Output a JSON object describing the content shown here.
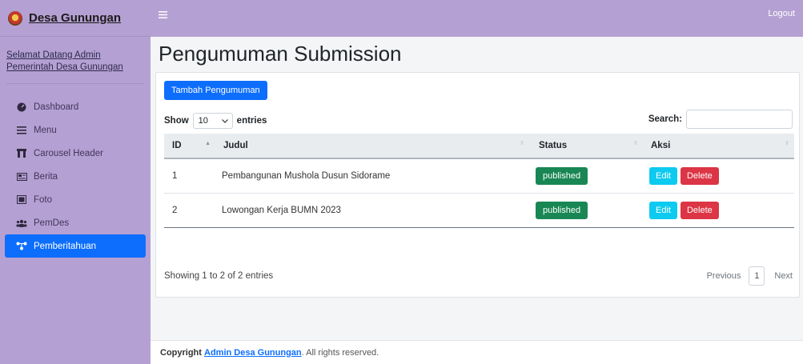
{
  "brand": {
    "name": "Desa Gunungan"
  },
  "topbar": {
    "menu_icon": "hamburger-icon",
    "logout_label": "Logout"
  },
  "sidebar": {
    "welcome": "Selamat Datang Admin Pemerintah Desa Gunungan",
    "items": [
      {
        "label": "Dashboard",
        "icon": "tachometer-icon"
      },
      {
        "label": "Menu",
        "icon": "bars-icon"
      },
      {
        "label": "Carousel Header",
        "icon": "archway-icon"
      },
      {
        "label": "Berita",
        "icon": "newspaper-icon"
      },
      {
        "label": "Foto",
        "icon": "image-icon"
      },
      {
        "label": "PemDes",
        "icon": "users-icon"
      },
      {
        "label": "Pemberitahuan",
        "icon": "network-icon",
        "active": true
      }
    ]
  },
  "main": {
    "title": "Pengumuman Submission",
    "add_button": "Tambah Pengumuman",
    "show_label": "Show",
    "entries_value": "10",
    "entries_label": "entries",
    "search_label": "Search:",
    "search_placeholder": "",
    "table": {
      "columns": [
        "ID",
        "Judul",
        "Status",
        "Aksi"
      ],
      "rows": [
        {
          "id": "1",
          "judul": "Pembangunan Mushola Dusun Sidorame",
          "status": "published",
          "edit": "Edit",
          "delete": "Delete"
        },
        {
          "id": "2",
          "judul": "Lowongan Kerja BUMN 2023",
          "status": "published",
          "edit": "Edit",
          "delete": "Delete"
        }
      ]
    },
    "info": "Showing 1 to 2 of 2 entries",
    "pagination": {
      "previous": "Previous",
      "current": "1",
      "next": "Next"
    }
  },
  "footer": {
    "prefix": "Copyright",
    "owner": "Admin Desa Gunungan",
    "suffix": ". All rights reserved."
  },
  "colors": {
    "sidebar": "#b5a0d3",
    "primary": "#0d6efd",
    "success": "#198754",
    "info": "#0dcaf0",
    "danger": "#dc3545"
  }
}
